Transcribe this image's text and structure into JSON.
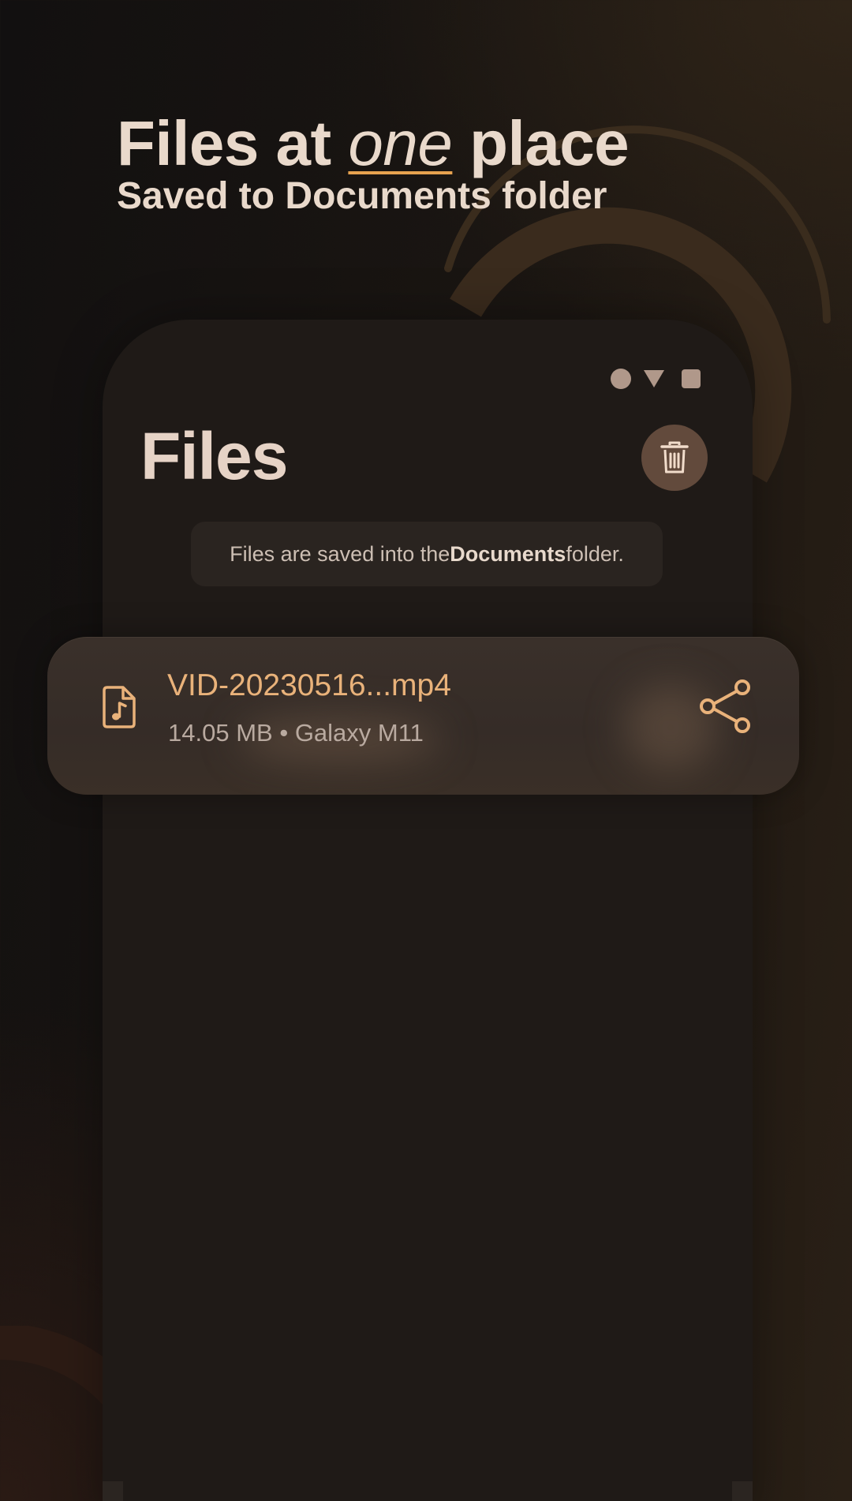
{
  "headline": {
    "title_before": "Files at ",
    "title_emphasis": "one",
    "title_after": " place",
    "subtitle": "Saved to Documents folder"
  },
  "screen": {
    "title": "Files",
    "info": {
      "before": "Files are saved into the ",
      "emphasis": "Documents",
      "after": " folder."
    }
  },
  "file": {
    "name": "VID-20230516...mp4",
    "size": "14.05 MB",
    "separator": "•",
    "device": "Galaxy M11"
  },
  "icons": {
    "delete": "trash-icon",
    "file": "audio-file-icon",
    "share": "share-icon"
  },
  "colors": {
    "accent": "#e9b27a",
    "background": "#1f1a17",
    "text": "#e9d9cb"
  }
}
